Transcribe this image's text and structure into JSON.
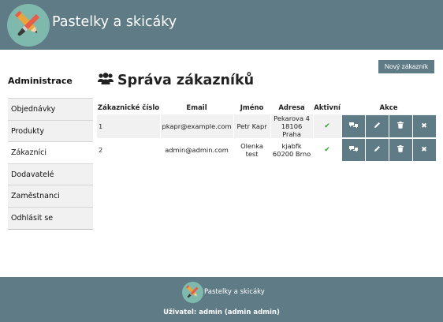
{
  "header": {
    "title": "Pastelky a skicáky",
    "logo": "pencil-brush-logo"
  },
  "sidebar": {
    "title": "Administrace",
    "items": [
      {
        "label": "Objednávky"
      },
      {
        "label": "Produkty"
      },
      {
        "label": "Zákazníci",
        "active": true
      },
      {
        "label": "Dodavatelé"
      },
      {
        "label": "Zaměstnanci"
      },
      {
        "label": "Odhlásit se"
      }
    ]
  },
  "main": {
    "title": "Správa zákazníků",
    "title_icon": "users-icon",
    "new_button": "Nový zákazník",
    "table": {
      "headers": [
        "Zákaznické číslo",
        "Email",
        "Jméno",
        "Adresa",
        "Aktivní",
        "Akce"
      ],
      "rows": [
        {
          "id": "1",
          "email": "pkapr@example.com",
          "name": "Petr Kapr",
          "address_line1": "Pekarova 4",
          "address_line2": "18106 Praha",
          "active": "✔"
        },
        {
          "id": "2",
          "email": "admin@admin.com",
          "name": "Olenka test",
          "address_line1": "kjabfk",
          "address_line2": "60200 Brno",
          "active": "✔"
        }
      ],
      "action_icons": [
        "comments-icon",
        "pencil-icon",
        "trash-icon",
        "close-icon"
      ]
    }
  },
  "footer": {
    "title": "Pastelky a skicáky",
    "user": "Uživatel: admin (admin admin)"
  },
  "colors": {
    "brand": "#5f7b86",
    "logo_bg": "#7fb9ae",
    "check": "#2ca02c"
  }
}
